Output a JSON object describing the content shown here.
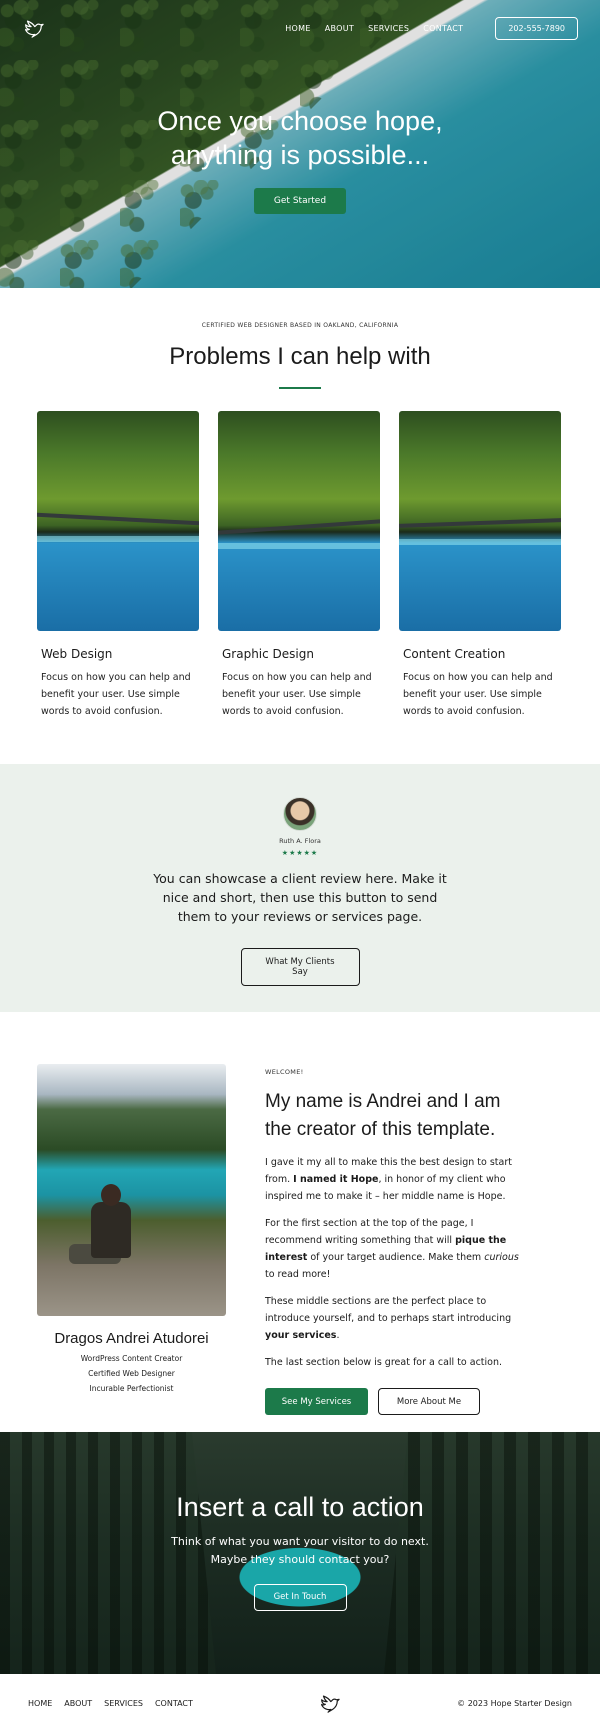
{
  "nav": {
    "links": [
      "HOME",
      "ABOUT",
      "SERVICES",
      "CONTACT"
    ],
    "phone": "202-555-7890",
    "logo_icon": "bird-icon"
  },
  "hero": {
    "title": "Once you choose hope, anything is possible...",
    "cta": "Get Started"
  },
  "services": {
    "eyebrow": "CERTIFIED WEB DESIGNER BASED IN OAKLAND, CALIFORNIA",
    "title": "Problems I can help with",
    "cards": [
      {
        "title": "Web Design",
        "text": "Focus on how you can help and benefit your user. Use simple words to avoid confusion."
      },
      {
        "title": "Graphic Design",
        "text": "Focus on how you can help and benefit your user. Use simple words to avoid confusion."
      },
      {
        "title": "Content Creation",
        "text": "Focus on how you can help and benefit your user. Use simple words to avoid confusion."
      }
    ]
  },
  "testimonial": {
    "name": "Ruth A. Flora",
    "stars": "★★★★★",
    "text": "You can showcase a client review here. Make it nice and short, then use this button to send them to your reviews or services page.",
    "button": "What My Clients Say"
  },
  "about": {
    "name": "Dragos Andrei Atudorei",
    "roles": [
      "WordPress Content Creator",
      "Certified Web Designer",
      "Incurable Perfectionist"
    ],
    "eyebrow": "WELCOME!",
    "title": "My name is Andrei and I am the creator of this template.",
    "p1_a": "I gave it my all to make this the best design to start from. ",
    "p1_b": "I named it Hope",
    "p1_c": ", in honor of my client who inspired me to make it – her middle name is Hope.",
    "p2_a": "For the first section at the top of the page, I recommend writing something that will ",
    "p2_b": "pique the interest",
    "p2_c": " of your target audience. Make them ",
    "p2_d": "curious",
    "p2_e": " to read more!",
    "p3_a": "These middle sections are the perfect place to introduce yourself, and to perhaps start introducing ",
    "p3_b": "your services",
    "p3_c": ".",
    "p4": "The last section below is great for a call to action.",
    "btn_primary": "See My Services",
    "btn_secondary": "More About Me"
  },
  "cta": {
    "title": "Insert a call to action",
    "line1": "Think of what you want your visitor to do next.",
    "line2": "Maybe they should contact you?",
    "button": "Get In Touch"
  },
  "footer": {
    "links": [
      "HOME",
      "ABOUT",
      "SERVICES",
      "CONTACT"
    ],
    "copyright": "© 2023 Hope Starter Design"
  },
  "colors": {
    "accent": "#1c7a4a",
    "testimonial_bg": "#ebf1ec"
  }
}
